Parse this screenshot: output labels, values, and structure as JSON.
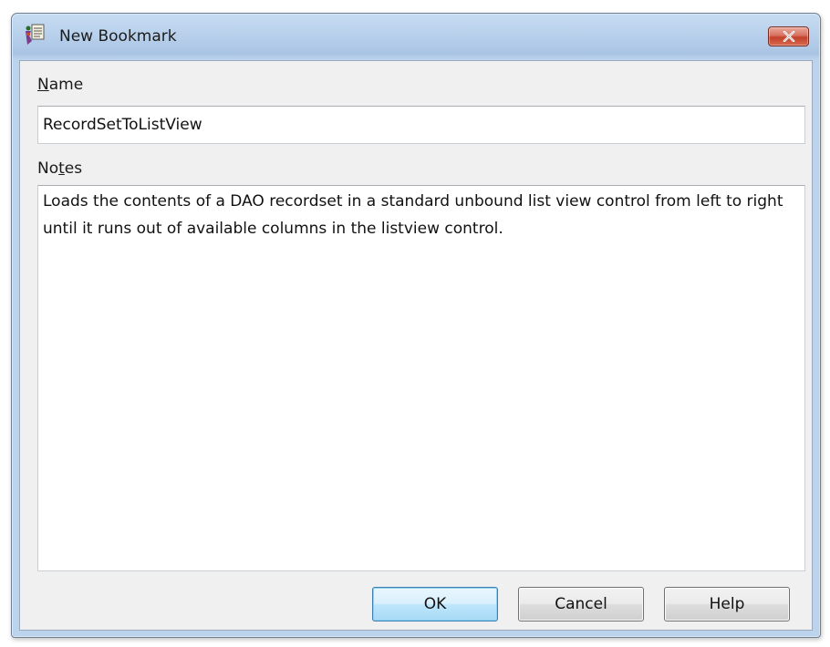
{
  "window": {
    "title": "New Bookmark",
    "close_label": "×"
  },
  "form": {
    "name_label_accesskey": "N",
    "name_label_rest": "ame",
    "name_value": "RecordSetToListView",
    "notes_label_pre": "No",
    "notes_label_accesskey": "t",
    "notes_label_post": "es",
    "notes_value": "Loads the contents of a DAO recordset in a standard unbound list view control from left to right  until it runs out of available columns in the listview control."
  },
  "buttons": {
    "ok": "OK",
    "cancel": "Cancel",
    "help": "Help"
  }
}
